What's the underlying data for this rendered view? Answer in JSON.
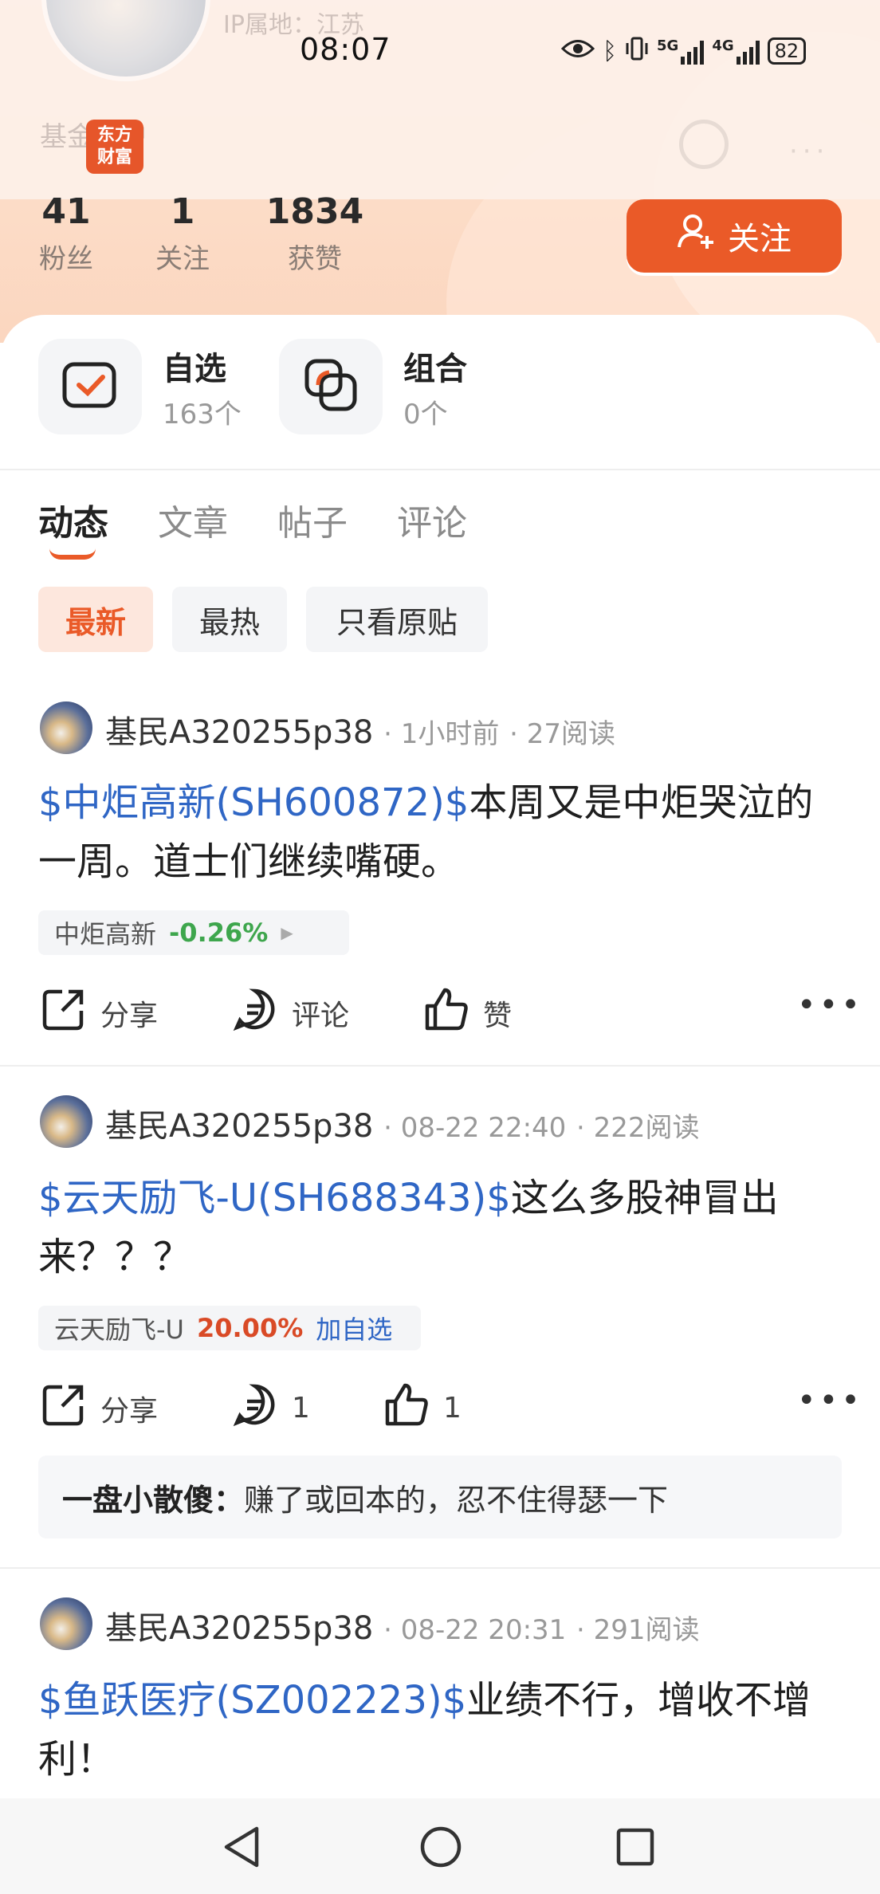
{
  "status_bar": {
    "time": "08:07",
    "net1": "5G",
    "net2": "4G",
    "battery": "82"
  },
  "header": {
    "ip_location": "IP属地：江苏",
    "account_type": "基金账户",
    "logo_text": "东方财富",
    "stats": [
      {
        "value": "41",
        "label": "粉丝"
      },
      {
        "value": "1",
        "label": "关注"
      },
      {
        "value": "1834",
        "label": "获赞"
      }
    ],
    "follow_label": "关注"
  },
  "shortcuts": [
    {
      "title": "自选",
      "count": "163个"
    },
    {
      "title": "组合",
      "count": "0个"
    }
  ],
  "tabs": [
    "动态",
    "文章",
    "帖子",
    "评论"
  ],
  "filters": [
    "最新",
    "最热",
    "只看原贴"
  ],
  "posts": [
    {
      "author": "基民A320255p38",
      "time": "1小时前",
      "reads": "27阅读",
      "stock_link": "$中炬高新(SH600872)$",
      "text": "本周又是中炬哭泣的一周。道士们继续嘴硬。",
      "tag_name": "中炬高新",
      "tag_change": "-0.26%",
      "share": "分享",
      "comment": "评论",
      "like": "赞"
    },
    {
      "author": "基民A320255p38",
      "time": "08-22 22:40",
      "reads": "222阅读",
      "stock_link": "$云天励飞-U(SH688343)$",
      "text": "这么多股神冒出来？？？",
      "tag_name": "云天励飞-U",
      "tag_change": "20.00%",
      "tag_action": "加自选",
      "share": "分享",
      "comment": "1",
      "like": "1",
      "top_comment_author": "一盘小散傻：",
      "top_comment_text": "赚了或回本的，忍不住得瑟一下"
    },
    {
      "author": "基民A320255p38",
      "time": "08-22 20:31",
      "reads": "291阅读",
      "stock_link": "$鱼跃医疗(SZ002223)$",
      "text": "业绩不行，增收不增利！"
    }
  ],
  "colors": {
    "accent": "#ea5a28",
    "link": "#2f66c5",
    "down": "#3ea64d",
    "up": "#d94a26"
  }
}
